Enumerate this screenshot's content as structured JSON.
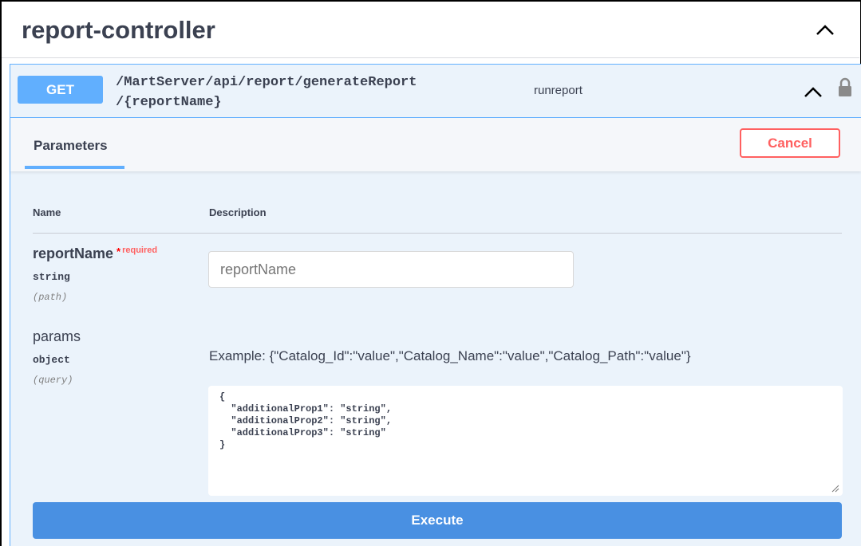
{
  "tag": {
    "title": "report-controller",
    "chevron_icon": "chevron-up-icon"
  },
  "operation": {
    "method": "GET",
    "path_line1": "/MartServer/api/report/generateReport",
    "path_line2": "/{reportName}",
    "description": "runreport",
    "chevron_icon": "chevron-up-icon",
    "lock_icon": "lock-icon"
  },
  "tabs": {
    "parameters": "Parameters",
    "cancel": "Cancel"
  },
  "table": {
    "col_name": "Name",
    "col_description": "Description"
  },
  "params": [
    {
      "name": "reportName",
      "required_star": "*",
      "required_label": "required",
      "type": "string",
      "in": "(path)",
      "placeholder": "reportName"
    },
    {
      "name": "params",
      "type": "object",
      "in": "(query)",
      "example": "Example: {\"Catalog_Id\":\"value\",\"Catalog_Name\":\"value\",\"Catalog_Path\":\"value\"}",
      "value": "{\n  \"additionalProp1\": \"string\",\n  \"additionalProp2\": \"string\",\n  \"additionalProp3\": \"string\"\n}"
    }
  ],
  "execute": "Execute",
  "colors": {
    "get_blue": "#61affe",
    "block_bg": "#ebf3fb",
    "cancel_red": "#ff6060",
    "execute_blue": "#4990e2"
  }
}
